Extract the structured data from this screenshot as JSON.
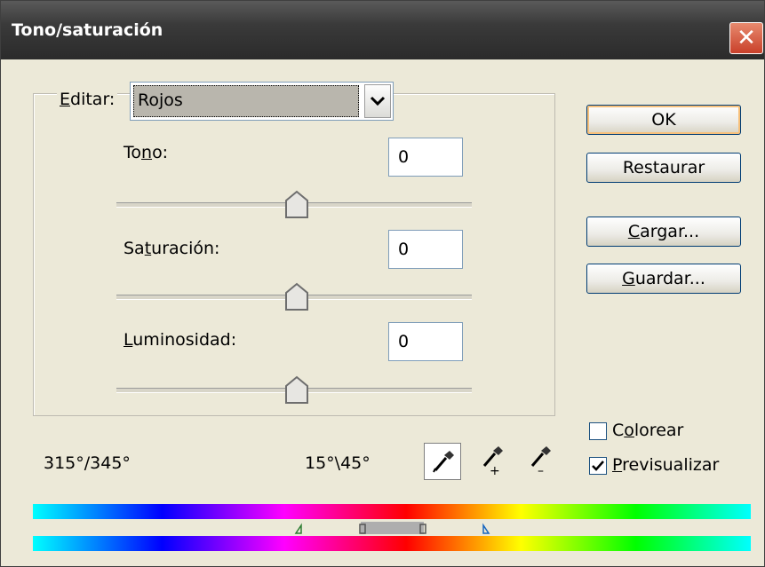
{
  "window": {
    "title": "Tono/saturación",
    "close": "✕"
  },
  "edit": {
    "label": "Editar:",
    "selected": "Rojos"
  },
  "hue": {
    "label": "Tono:",
    "value": "0",
    "level": 0.5
  },
  "saturation": {
    "label": "Saturación:",
    "value": "0",
    "level": 0.5
  },
  "lightness": {
    "label": "Luminosidad:",
    "value": "0",
    "level": 0.5
  },
  "buttons": {
    "ok": "OK",
    "reset": "Restaurar",
    "load": "Cargar...",
    "save": "Guardar..."
  },
  "options": {
    "colorize": "Colorear",
    "colorize_checked": false,
    "preview": "Previsualizar",
    "preview_checked": true
  },
  "range": {
    "left": "315°/345°",
    "right": "15°\\45°"
  },
  "icons": [
    "eyedropper-icon",
    "eyedropper-plus-icon",
    "eyedropper-minus-icon",
    "chevron-down-icon",
    "close-icon",
    "checkmark-icon"
  ],
  "colors": {
    "title_bar": "#3a3a3a",
    "close": "#c9402a",
    "dialog_bg": "#ece9d8",
    "ok_focus": "#f7c07a"
  }
}
